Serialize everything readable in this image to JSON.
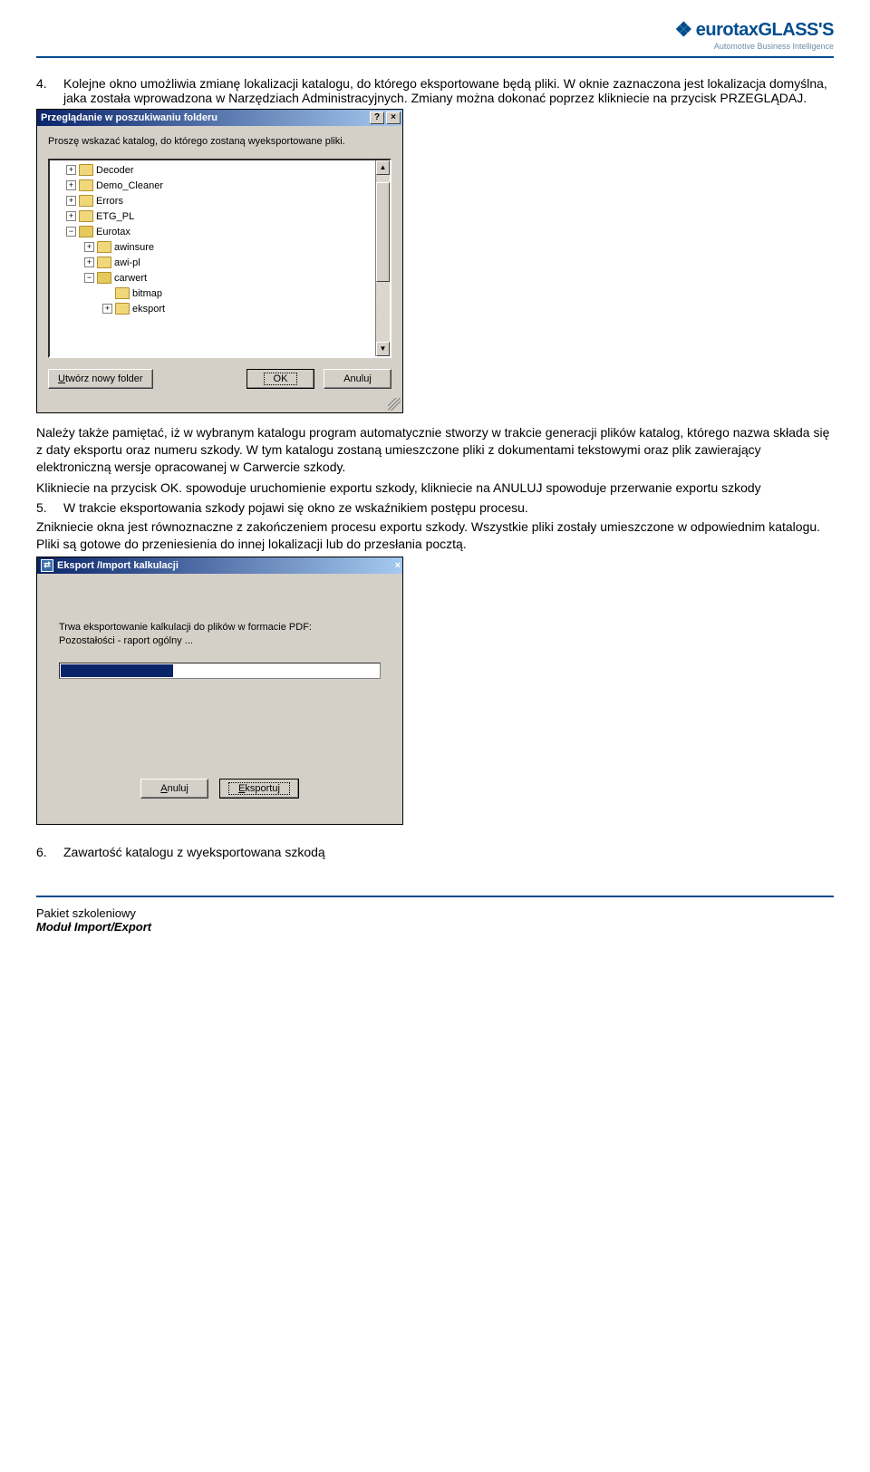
{
  "logo": {
    "arrow": "❖",
    "main": "eurotaxGLASS'S",
    "sub": "Automotive Business Intelligence"
  },
  "items": {
    "i4": {
      "num": "4.",
      "text": "Kolejne okno umożliwia zmianę lokalizacji katalogu, do którego eksportowane będą pliki. W oknie zaznaczona jest lokalizacja domyślna, jaka została wprowadzona w Narzędziach Administracyjnych. Zmiany można dokonać poprzez klikniecie na przycisk PRZEGLĄDAJ."
    },
    "i5": {
      "num": "5.",
      "text": "W trakcie eksportowania szkody pojawi się okno ze wskaźnikiem postępu procesu."
    },
    "i6": {
      "num": "6.",
      "text": "Zawartość katalogu z wyeksportowana szkodą"
    }
  },
  "paras": {
    "p1": "Należy także pamiętać, iż w wybranym katalogu program automatycznie stworzy w trakcie generacji plików katalog, którego nazwa składa się z daty eksportu oraz numeru szkody. W tym katalogu zostaną umieszczone pliki z dokumentami tekstowymi oraz plik zawierający elektroniczną wersje opracowanej w Carwercie szkody.",
    "p2": "Klikniecie na przycisk OK. spowoduje uruchomienie exportu szkody, klikniecie na ANULUJ spowoduje przerwanie exportu szkody",
    "p3": "Znikniecie okna jest równoznaczne z zakończeniem procesu exportu szkody. Wszystkie pliki zostały umieszczone w odpowiednim katalogu. Pliki są gotowe do przeniesienia do innej lokalizacji lub do przesłania pocztą."
  },
  "dlg1": {
    "title": "Przeglądanie w poszukiwaniu folderu",
    "help": "?",
    "close": "×",
    "msg": "Proszę wskazać katalog, do którego zostaną wyeksportowane pliki.",
    "tree": {
      "decoder": "Decoder",
      "demo": "Demo_Cleaner",
      "errors": "Errors",
      "etg": "ETG_PL",
      "eurotax": "Eurotax",
      "awinsure": "awinsure",
      "awipl": "awi-pl",
      "carwert": "carwert",
      "bitmap": "bitmap",
      "eksport": "eksport"
    },
    "btn_new_u": "U",
    "btn_new": "twórz nowy folder",
    "btn_ok": "OK",
    "btn_cancel": "Anuluj",
    "up": "▲",
    "down": "▼"
  },
  "dlg2": {
    "title": "Eksport /Import kalkulacji",
    "close": "×",
    "line1": "Trwa eksportowanie kalkulacji do plików w formacie PDF:",
    "line2": "Pozostałości - raport ogólny ...",
    "btn_cancel_u": "A",
    "btn_cancel": "nuluj",
    "btn_export_u": "E",
    "btn_export": "ksportuj"
  },
  "footer": {
    "l1": "Pakiet szkoleniowy",
    "l2": "Moduł Import/Export"
  }
}
